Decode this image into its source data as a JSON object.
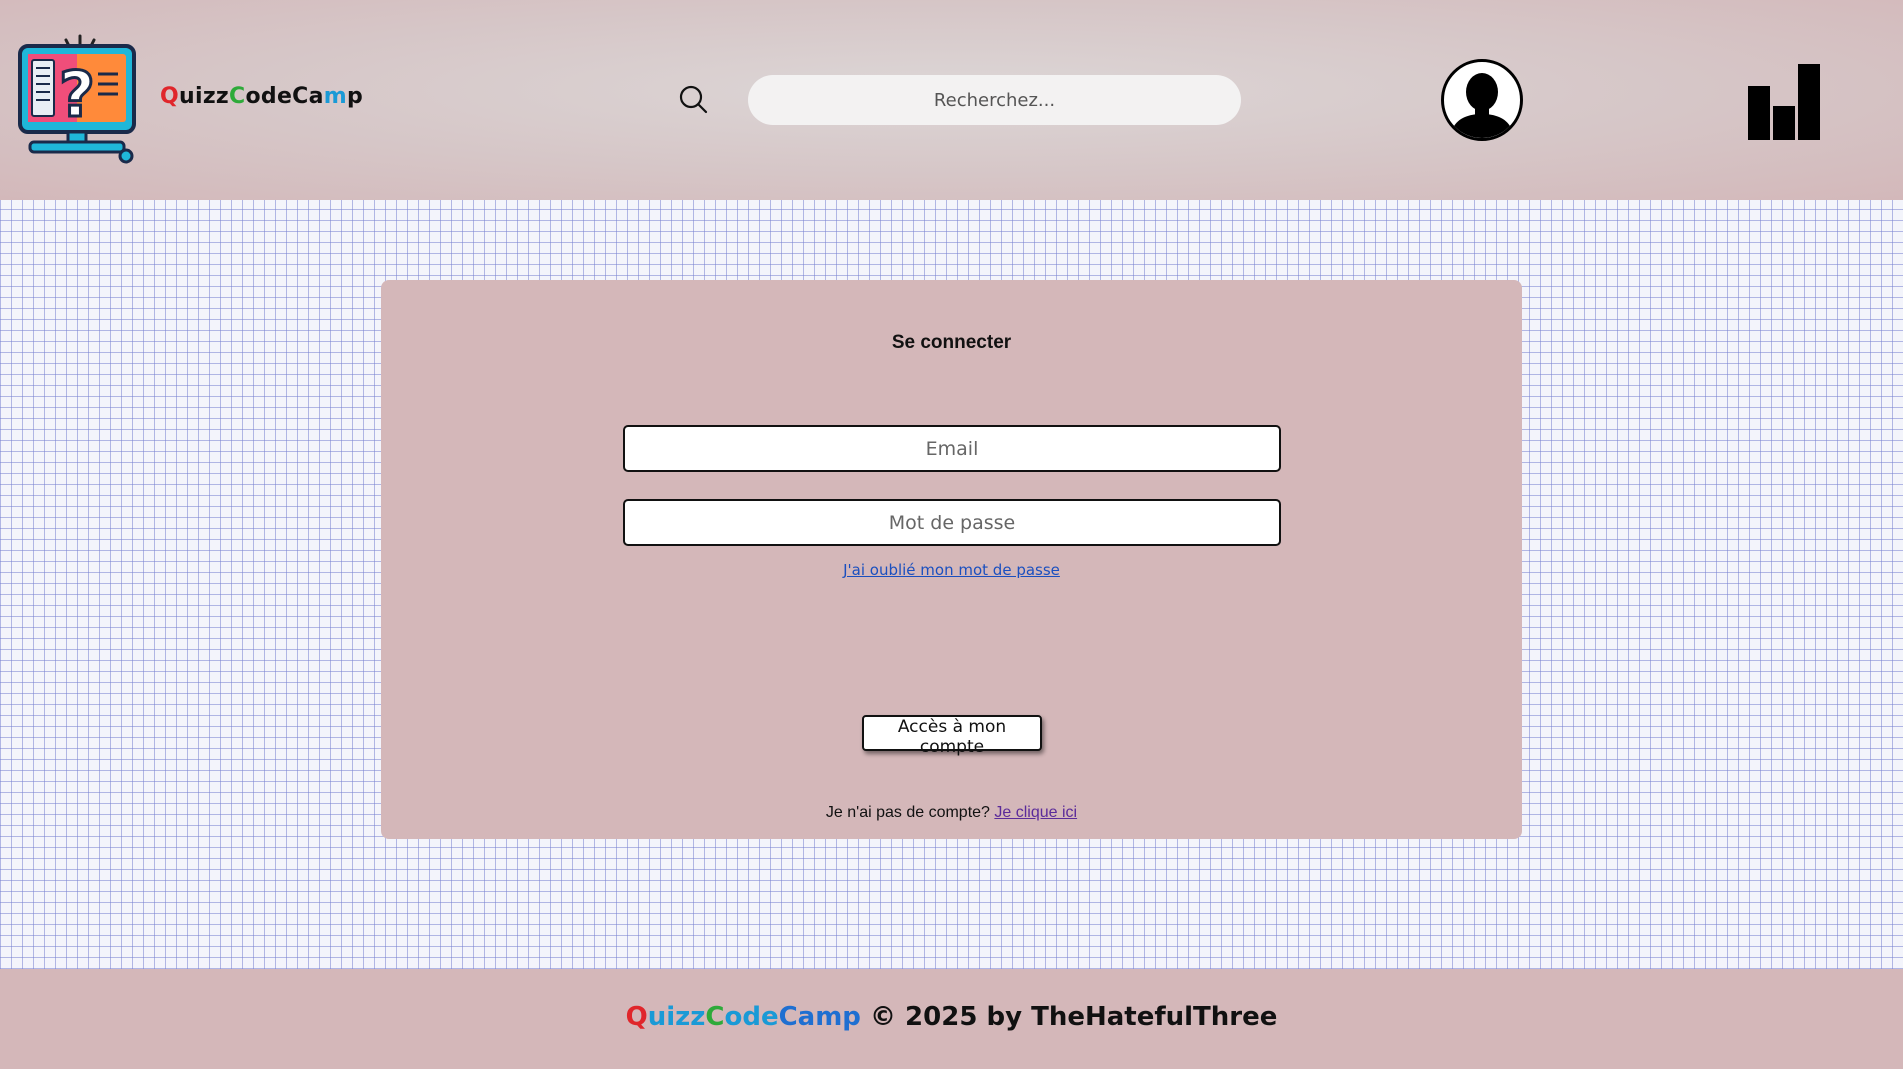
{
  "header": {
    "brand": {
      "parts": [
        "Q",
        "uizz",
        "C",
        "ode",
        "Ca",
        "m",
        "p"
      ]
    },
    "search": {
      "placeholder": "Recherchez..."
    }
  },
  "login": {
    "title": "Se connecter",
    "email_placeholder": "Email",
    "password_placeholder": "Mot de passe",
    "forgot_password": "J'ai oublié mon mot de passe",
    "submit_label": "Accès à mon compte",
    "no_account_text": "Je n'ai pas de compte?",
    "signup_link": "Je clique ici"
  },
  "footer": {
    "brand_parts": [
      "Q",
      "uizz",
      "C",
      "ode",
      "Camp"
    ],
    "rest": "© 2025 by TheHatefulThree"
  },
  "colors": {
    "header_bg": "#d6c6c7",
    "card_bg": "#d4b7b9",
    "footer_bg": "#d4b7b9",
    "brand_red": "#e0262b",
    "brand_green": "#2eaa3a",
    "brand_blue": "#1f6fd1",
    "link_blue": "#1a4fbf",
    "link_visited": "#5b2b9a"
  },
  "icons": {
    "logo": "quiz-monitor-logo-icon",
    "search": "search-icon",
    "avatar": "user-silhouette-icon",
    "stats": "bar-chart-icon"
  }
}
